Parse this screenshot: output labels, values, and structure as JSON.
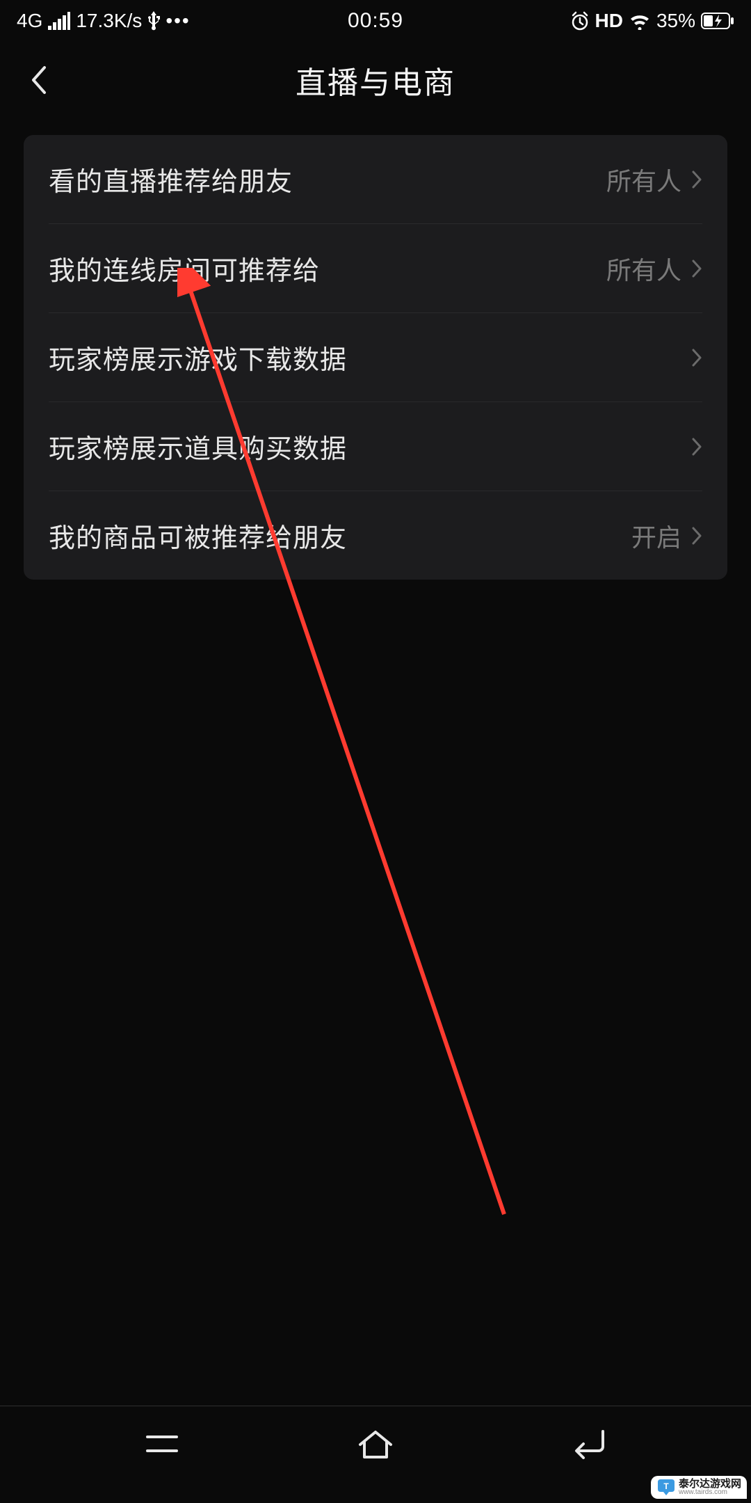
{
  "statusBar": {
    "network": "4G",
    "speed": "17.3K/s",
    "time": "00:59",
    "hdLabel": "HD",
    "batteryPercent": "35%"
  },
  "header": {
    "title": "直播与电商"
  },
  "settings": {
    "items": [
      {
        "label": "看的直播推荐给朋友",
        "value": "所有人"
      },
      {
        "label": "我的连线房间可推荐给",
        "value": "所有人"
      },
      {
        "label": "玩家榜展示游戏下载数据",
        "value": ""
      },
      {
        "label": "玩家榜展示道具购买数据",
        "value": ""
      },
      {
        "label": "我的商品可被推荐给朋友",
        "value": "开启"
      }
    ]
  },
  "watermark": {
    "name": "泰尔达游戏网",
    "sub": "www.tairds.com"
  }
}
